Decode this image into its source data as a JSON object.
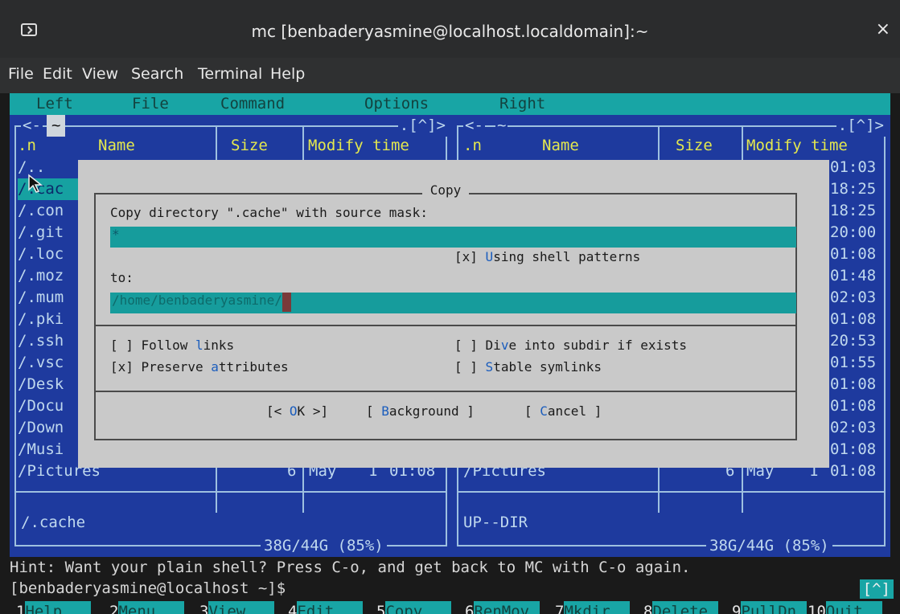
{
  "window": {
    "title": "mc [benbaderyasmine@localhost.localdomain]:~",
    "close_glyph": "×"
  },
  "terminal_menu": [
    "File",
    "Edit",
    "View",
    "Search",
    "Terminal",
    "Help"
  ],
  "mc_menu": [
    "Left",
    "File",
    "Command",
    "Options",
    "Right"
  ],
  "left_panel": {
    "title": "~",
    "title_prefix": "<-",
    "title_suffix": ".[^]>",
    "columns": {
      "n": ".n",
      "name": "Name",
      "size": "Size",
      "mtime": "Modify time"
    },
    "rows": [
      "/..",
      "/.cac",
      "/.con",
      "/.git",
      "/.loc",
      "/.moz",
      "/.mum",
      "/.pki",
      "/.ssh",
      "/.vsc",
      "/Desk",
      "/Docu",
      "/Down",
      "/Musi"
    ],
    "last_row": {
      "name": "/Pictures",
      "size": "6",
      "month": "May",
      "day": "1",
      "time": "01:08"
    },
    "current": "/.cache",
    "status": "38G/44G (85%)"
  },
  "right_panel": {
    "title": "~",
    "title_prefix": "<-",
    "title_suffix": ".[^]>",
    "columns": {
      "n": ".n",
      "name": "Name",
      "size": "Size",
      "mtime": "Modify time"
    },
    "times": [
      "01:03",
      "18:25",
      "18:25",
      "20:00",
      "01:08",
      "01:48",
      "02:03",
      "01:08",
      "20:53",
      "01:55",
      "01:08",
      "01:08",
      "02:03",
      "01:08"
    ],
    "last_row": {
      "name": "/Pictures",
      "size": "6",
      "month": "May",
      "day": "1",
      "time": "01:08"
    },
    "current": "UP--DIR",
    "status": "38G/44G (85%)"
  },
  "dialog": {
    "title": "Copy",
    "prompt": "Copy directory \".cache\" with source mask:",
    "mask_value": "*",
    "shell_patterns": {
      "check": "[x]",
      "label_hot": "U",
      "label_rest": "sing shell patterns"
    },
    "to_label": "to:",
    "dest_value": "/home/benbaderyasmine/",
    "follow_links": {
      "check": "[ ]",
      "a": "Follow ",
      "hot": "l",
      "b": "inks"
    },
    "preserve_attrs": {
      "check": "[x]",
      "a": "Preserve ",
      "hot": "a",
      "b": "ttributes"
    },
    "dive_subdir": {
      "check": "[ ]",
      "a": "Di",
      "hot": "v",
      "b": "e into subdir if exists"
    },
    "stable_symlinks": {
      "check": "[ ]",
      "a": "",
      "hot": "S",
      "b": "table symlinks"
    },
    "buttons": {
      "ok": {
        "pre": "[< ",
        "hot": "O",
        "rest": "K >]"
      },
      "background": {
        "pre": "[ ",
        "hot": "B",
        "rest": "ackground ]"
      },
      "cancel": {
        "pre": "[ ",
        "hot": "C",
        "rest": "ancel ]"
      }
    }
  },
  "hint": "Hint: Want your plain shell? Press C-o, and get back to MC with C-o again.",
  "prompt": "[benbaderyasmine@localhost ~]$",
  "corner": "[^]",
  "fkeys": [
    {
      "n": "1",
      "label": "Help"
    },
    {
      "n": "2",
      "label": "Menu"
    },
    {
      "n": "3",
      "label": "View"
    },
    {
      "n": "4",
      "label": "Edit"
    },
    {
      "n": "5",
      "label": "Copy"
    },
    {
      "n": "6",
      "label": "RenMov"
    },
    {
      "n": "7",
      "label": "Mkdir"
    },
    {
      "n": "8",
      "label": "Delete"
    },
    {
      "n": "9",
      "label": "PullDn"
    },
    {
      "n": "10",
      "label": "Quit"
    }
  ],
  "colors": {
    "panel_bg": "#1e3a9e",
    "accent": "#18a5a5",
    "dialog_bg": "#c9c9c9",
    "header": "#e4e84e"
  }
}
